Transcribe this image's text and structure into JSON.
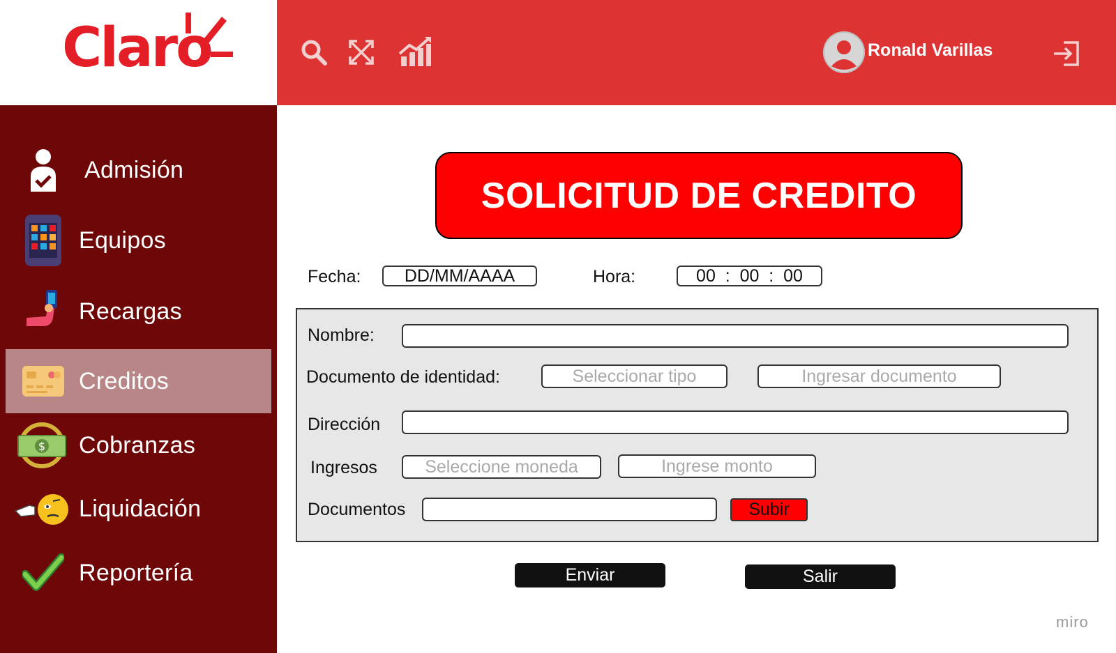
{
  "brand": {
    "name": "Claro",
    "color": "#e41e26"
  },
  "header": {
    "icons": [
      "search-icon",
      "expand-icon",
      "chart-icon"
    ],
    "user_name": "Ronald Varillas",
    "logout_icon": "logout-icon",
    "bg_color": "#dd3333"
  },
  "sidebar": {
    "bg_color": "#6e0808",
    "active_color": "#b88686",
    "items": [
      {
        "label": "Admisión",
        "icon": "user-check-icon",
        "active": false
      },
      {
        "label": "Equipos",
        "icon": "phone-apps-icon",
        "active": false
      },
      {
        "label": "Recargas",
        "icon": "hand-phone-icon",
        "active": false
      },
      {
        "label": "Creditos",
        "icon": "credit-card-icon",
        "active": true
      },
      {
        "label": "Cobranzas",
        "icon": "money-icon",
        "active": false
      },
      {
        "label": "Liquidación",
        "icon": "pointing-emoji-icon",
        "active": false
      },
      {
        "label": "Reportería",
        "icon": "checkmark-icon",
        "active": false
      }
    ]
  },
  "main": {
    "title": "SOLICITUD DE CREDITO",
    "fecha_label": "Fecha:",
    "fecha_value": "DD/MM/AAAA",
    "hora_label": "Hora:",
    "hora_value": "00  :  00  :  00",
    "form": {
      "nombre_label": "Nombre:",
      "nombre_value": "",
      "documento_label": "Documento de identidad:",
      "documento_tipo_placeholder": "Seleccionar tipo",
      "documento_numero_placeholder": "Ingresar documento",
      "direccion_label": "Dirección",
      "direccion_value": "",
      "ingresos_label": "Ingresos",
      "moneda_placeholder": "Seleccione moneda",
      "monto_placeholder": "Ingrese monto",
      "documentos_label": "Documentos",
      "documentos_value": "",
      "subir_label": "Subir"
    },
    "enviar_label": "Enviar",
    "salir_label": "Salir"
  },
  "watermark": "miro"
}
